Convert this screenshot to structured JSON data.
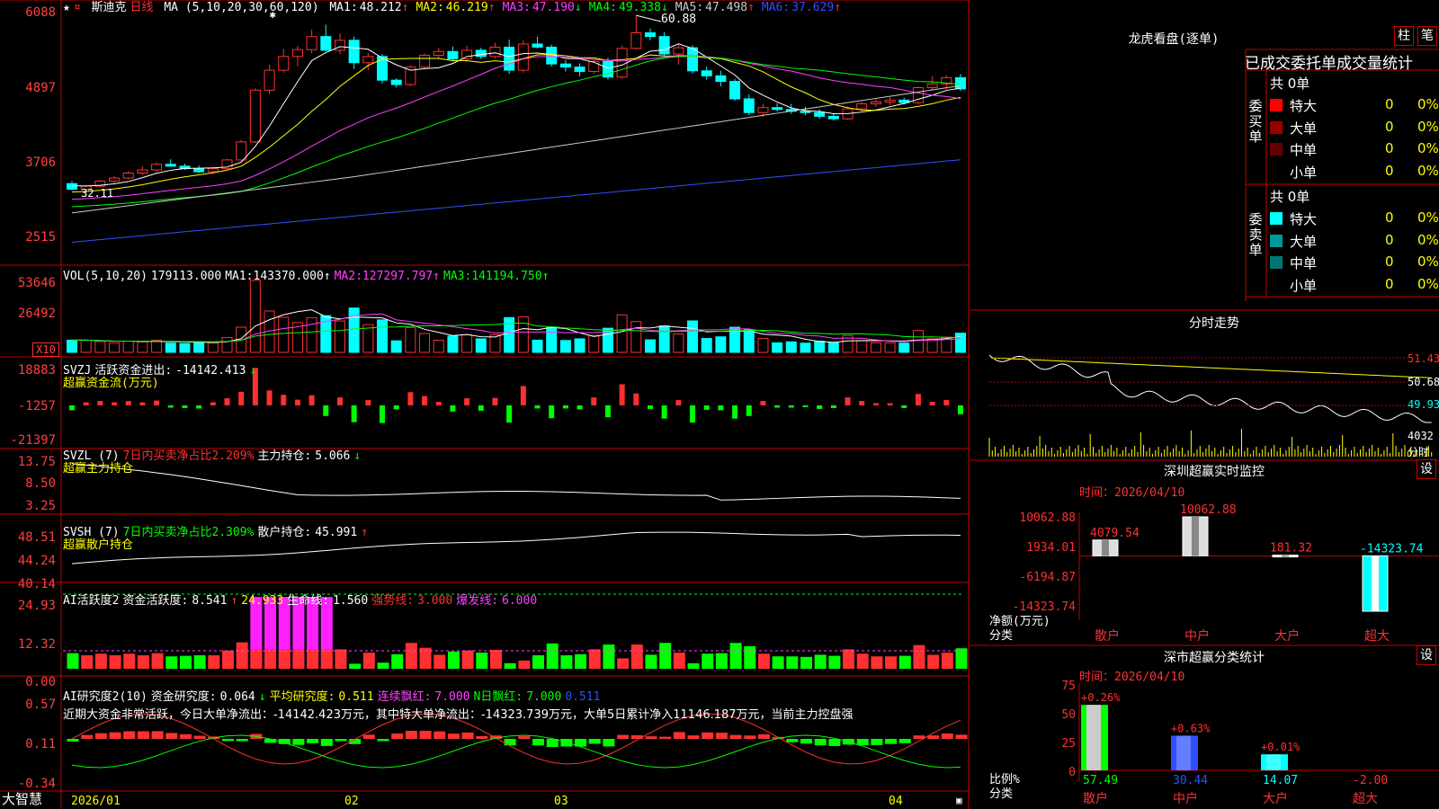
{
  "app_name": "大智慧",
  "stock": {
    "name": "斯迪克",
    "period": "日线"
  },
  "price_panel": {
    "ma_label": "MA (5,10,20,30,60,120)",
    "ma_values": [
      {
        "name": "MA1",
        "value": "48.212",
        "arrow": "↑",
        "color": "#ffffff"
      },
      {
        "name": "MA2",
        "value": "46.219",
        "arrow": "↑",
        "color": "#ffff00"
      },
      {
        "name": "MA3",
        "value": "47.190",
        "arrow": "↓",
        "color": "#ff40ff"
      },
      {
        "name": "MA4",
        "value": "49.338",
        "arrow": "↓",
        "color": "#00ff00"
      },
      {
        "name": "MA5",
        "value": "47.498",
        "arrow": "↑",
        "color": "#cccccc"
      },
      {
        "name": "MA6",
        "value": "37.629",
        "arrow": "↑",
        "color": "#3050ff"
      }
    ],
    "yticks": [
      "6088",
      "4897",
      "3706",
      "2515"
    ],
    "high_label": "60.88",
    "low_label": "32.11"
  },
  "vol_panel": {
    "label": "VOL(5,10,20)",
    "value": "179113.000",
    "arrow": "↑",
    "ma": [
      {
        "name": "MA1",
        "value": "143370.000",
        "arrow": "↑",
        "color": "#ffffff"
      },
      {
        "name": "MA2",
        "value": "127297.797",
        "arrow": "↑",
        "color": "#ff40ff"
      },
      {
        "name": "MA3",
        "value": "141194.750",
        "arrow": "↑",
        "color": "#00ff00"
      }
    ],
    "yticks": [
      "53646",
      "26492"
    ],
    "unit": "X10"
  },
  "svzj_panel": {
    "label": "SVZJ",
    "metric": "活跃资金进出:",
    "value": "-14142.413",
    "arrow": "↓",
    "subtitle": "超赢资金流(万元)",
    "yticks": [
      "18883",
      "-1257",
      "-21397"
    ]
  },
  "svzl_panel": {
    "label": "SVZL (7)",
    "ratio": "7日内买卖净占比2.209%",
    "metric": "主力持仓:",
    "value": "5.066",
    "arrow": "↓",
    "subtitle": "超赢主力持仓",
    "yticks": [
      "13.75",
      "8.50",
      "3.25"
    ]
  },
  "svsh_panel": {
    "label": "SVSH (7)",
    "ratio": "7日内买卖净占比2.309%",
    "metric": "散户持仓:",
    "value": "45.991",
    "arrow": "↑",
    "subtitle": "超赢散户持仓",
    "yticks": [
      "48.51",
      "44.24",
      "40.14"
    ]
  },
  "ai_active_panel": {
    "label": "AI活跃度2",
    "metric": "资金活跃度:",
    "value": "8.541",
    "arrow": "↑",
    "v2": "24.933",
    "life_label": "生命线:",
    "life": "1.560",
    "strong_label": "强势线:",
    "strong": "3.000",
    "burst_label": "爆发线:",
    "burst": "6.000",
    "yticks": [
      "24.93",
      "12.32",
      "0.00"
    ]
  },
  "ai_research_panel": {
    "label": "AI研究度2(10)",
    "metric": "资金研究度:",
    "value": "0.064",
    "arrow": "↓",
    "avg_label": "平均研究度:",
    "avg": "0.511",
    "cont_label": "连续飘红:",
    "cont": "7.000",
    "n_label": "N日飘红:",
    "n": "7.000",
    "last": "0.511",
    "comment": "近期大资金非常活跃，今日大单净流出：-14142.423万元，其中特大单净流出：-14323.739万元，大单5日累计净入11146.187万元，当前主力控盘强",
    "yticks": [
      "0.57",
      "0.11",
      "-0.34"
    ]
  },
  "x_axis": [
    "2026/01",
    "02",
    "03",
    "04"
  ],
  "lhb": {
    "title": "龙虎看盘(逐单)",
    "btn1": "柱",
    "btn2": "笔",
    "subtitle": "已成交委托单成交量统计",
    "buy": {
      "side": "委买单",
      "total": "共 0单",
      "rows": [
        {
          "label": "特大",
          "color": "#ff0000",
          "count": "0",
          "pct": "0%"
        },
        {
          "label": "大单",
          "color": "#990000",
          "count": "0",
          "pct": "0%"
        },
        {
          "label": "中单",
          "color": "#660000",
          "count": "0",
          "pct": "0%"
        },
        {
          "label": "小单",
          "color": "#000000",
          "count": "0",
          "pct": "0%"
        }
      ]
    },
    "sell": {
      "side": "委卖单",
      "total": "共 0单",
      "rows": [
        {
          "label": "特大",
          "color": "#00ffff",
          "count": "0",
          "pct": "0%"
        },
        {
          "label": "大单",
          "color": "#009999",
          "count": "0",
          "pct": "0%"
        },
        {
          "label": "中单",
          "color": "#007777",
          "count": "0",
          "pct": "0%"
        },
        {
          "label": "小单",
          "color": "#000000",
          "count": "0",
          "pct": "0%"
        }
      ]
    }
  },
  "intraday": {
    "title": "分时走势",
    "yticks": [
      "51.43",
      "50.68",
      "49.93"
    ],
    "vol": "4032",
    "vol_unit": "分时"
  },
  "sz_monitor": {
    "title": "深圳超赢实时监控",
    "btn": "设",
    "time": "时间：2026/04/10",
    "yticks": [
      "10062.88",
      "1934.01",
      "-6194.87",
      "-14323.74"
    ],
    "ylabel": "净额(万元)",
    "xlabel": "分类",
    "bars": [
      {
        "cat": "散户",
        "value": 4079.54,
        "label": "4079.54"
      },
      {
        "cat": "中户",
        "value": 10062.88,
        "label": "10062.88"
      },
      {
        "cat": "大户",
        "value": 181.32,
        "label": "181.32"
      },
      {
        "cat": "超大",
        "value": -14323.74,
        "label": "-14323.74"
      }
    ]
  },
  "sz_class": {
    "title": "深市超赢分类统计",
    "btn": "设",
    "time": "时间：2026/04/10",
    "yticks": [
      "75",
      "50",
      "25",
      "0"
    ],
    "ylabel": "比例%",
    "xlabel": "分类",
    "bars": [
      {
        "cat": "散户",
        "value": 57.49,
        "chg": "+0.26%",
        "label": "57.49",
        "color": "#00ff00"
      },
      {
        "cat": "中户",
        "value": 30.44,
        "chg": "+0.63%",
        "label": "30.44",
        "color": "#3050ff"
      },
      {
        "cat": "大户",
        "value": 14.07,
        "chg": "+0.01%",
        "label": "14.07",
        "color": "#00ffff"
      },
      {
        "cat": "超大",
        "value": -2.0,
        "chg": "",
        "label": "-2.00",
        "color": "#ff3030"
      }
    ]
  },
  "chart_data": {
    "type": "candlestick",
    "series_name": "斯迪克 日线",
    "candles": [
      [
        34.2,
        34.6,
        33.1,
        33.3
      ],
      [
        33.3,
        34.0,
        32.1,
        33.8
      ],
      [
        33.8,
        34.8,
        33.6,
        34.6
      ],
      [
        34.6,
        35.4,
        34.3,
        35.1
      ],
      [
        35.1,
        36.2,
        34.9,
        35.9
      ],
      [
        35.9,
        37.0,
        35.6,
        36.4
      ],
      [
        36.4,
        37.6,
        36.1,
        37.3
      ],
      [
        37.3,
        38.1,
        36.9,
        37.0
      ],
      [
        37.0,
        37.4,
        36.4,
        36.6
      ],
      [
        36.6,
        37.1,
        35.9,
        36.1
      ],
      [
        36.1,
        36.9,
        35.8,
        36.6
      ],
      [
        36.6,
        38.2,
        36.4,
        38.0
      ],
      [
        38.0,
        41.2,
        37.8,
        40.9
      ],
      [
        40.9,
        49.5,
        40.7,
        49.2
      ],
      [
        49.2,
        53.3,
        48.6,
        52.4
      ],
      [
        52.4,
        55.8,
        52.0,
        54.6
      ],
      [
        54.6,
        56.3,
        53.0,
        55.7
      ],
      [
        55.7,
        58.9,
        55.1,
        57.8
      ],
      [
        57.8,
        59.7,
        55.4,
        55.6
      ],
      [
        55.6,
        58.3,
        55.0,
        57.2
      ],
      [
        57.2,
        57.8,
        52.6,
        53.6
      ],
      [
        53.6,
        55.2,
        52.4,
        54.6
      ],
      [
        54.6,
        55.0,
        50.3,
        50.8
      ],
      [
        50.8,
        51.1,
        49.6,
        50.1
      ],
      [
        50.1,
        53.2,
        49.8,
        52.9
      ],
      [
        52.9,
        55.1,
        52.6,
        54.8
      ],
      [
        54.8,
        56.0,
        54.2,
        55.4
      ],
      [
        55.4,
        56.2,
        53.8,
        54.2
      ],
      [
        54.2,
        56.3,
        53.7,
        55.6
      ],
      [
        55.6,
        56.0,
        54.2,
        54.6
      ],
      [
        54.6,
        56.8,
        54.3,
        56.1
      ],
      [
        56.1,
        57.3,
        51.8,
        52.4
      ],
      [
        52.4,
        57.2,
        52.0,
        56.6
      ],
      [
        56.6,
        57.8,
        55.9,
        56.1
      ],
      [
        56.1,
        56.5,
        53.0,
        53.4
      ],
      [
        53.4,
        54.0,
        52.2,
        52.9
      ],
      [
        52.9,
        53.5,
        51.4,
        52.2
      ],
      [
        52.2,
        54.1,
        51.9,
        53.8
      ],
      [
        53.8,
        54.4,
        50.9,
        51.3
      ],
      [
        51.3,
        56.4,
        51.0,
        55.9
      ],
      [
        55.9,
        61.2,
        55.7,
        58.4
      ],
      [
        58.4,
        59.1,
        57.2,
        57.8
      ],
      [
        57.8,
        58.5,
        54.6,
        55.0
      ],
      [
        55.0,
        56.6,
        53.3,
        56.0
      ],
      [
        56.0,
        56.4,
        51.9,
        52.3
      ],
      [
        52.3,
        53.0,
        50.9,
        51.5
      ],
      [
        51.5,
        52.3,
        49.8,
        50.6
      ],
      [
        50.6,
        51.0,
        47.5,
        47.8
      ],
      [
        47.8,
        48.5,
        45.2,
        45.6
      ],
      [
        45.6,
        47.0,
        44.9,
        46.4
      ],
      [
        46.4,
        47.1,
        45.8,
        46.1
      ],
      [
        46.1,
        47.0,
        45.4,
        45.8
      ],
      [
        45.8,
        46.5,
        45.2,
        45.6
      ],
      [
        45.6,
        46.1,
        44.6,
        45.0
      ],
      [
        45.0,
        45.5,
        44.3,
        44.6
      ],
      [
        44.6,
        46.6,
        44.4,
        46.2
      ],
      [
        46.2,
        47.3,
        45.8,
        47.0
      ],
      [
        47.0,
        47.8,
        46.5,
        47.3
      ],
      [
        47.3,
        48.1,
        46.8,
        47.6
      ],
      [
        47.6,
        48.0,
        46.9,
        47.2
      ],
      [
        47.2,
        49.8,
        46.9,
        49.6
      ],
      [
        49.6,
        51.4,
        49.2,
        50.2
      ],
      [
        50.2,
        51.6,
        49.3,
        51.2
      ],
      [
        51.2,
        51.8,
        49.1,
        49.4
      ]
    ]
  }
}
